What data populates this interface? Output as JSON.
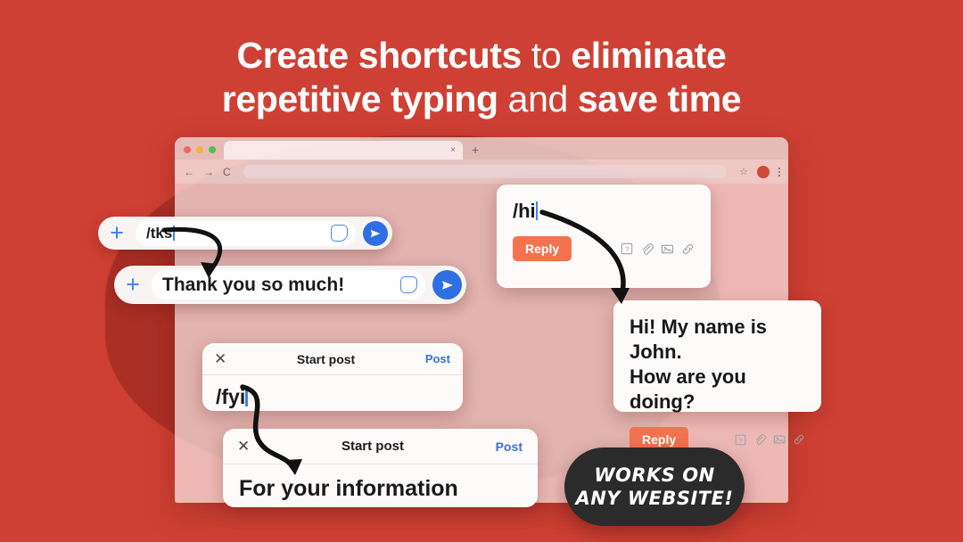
{
  "headline": {
    "line1_part1": "Create shortcuts",
    "line1_part2": " to ",
    "line1_part3": "eliminate",
    "line2_part1": "repetitive typing",
    "line2_part2": " and ",
    "line2_part3": "save time"
  },
  "browser": {
    "tab_close_label": "×",
    "new_tab_label": "+",
    "back_icon": "←",
    "forward_icon": "→",
    "reload_icon": "C",
    "bookmark_icon": "☆",
    "omnibox_value": "",
    "avatar_initial": "",
    "traffic_lights": [
      "close-red",
      "minimize-yellow",
      "maximize-green"
    ]
  },
  "chat_bars": [
    {
      "plus_label": "+",
      "text": "/tks",
      "has_caret": true,
      "sticker_icon": "sticker-icon",
      "send_icon": "send-icon"
    },
    {
      "plus_label": "+",
      "text": "Thank you so much!",
      "has_caret": false,
      "sticker_icon": "sticker-icon",
      "send_icon": "send-icon"
    }
  ],
  "reply_cards": [
    {
      "text": "/hi",
      "has_caret": true,
      "reply_label": "Reply",
      "icons": [
        "help-box-icon",
        "paperclip-icon",
        "image-icon",
        "link-icon"
      ]
    },
    {
      "text": "Hi! My name is John.\nHow are you doing?",
      "line1": "Hi! My name is John.",
      "line2": "How are you doing?",
      "has_caret": false,
      "reply_label": "Reply",
      "icons": [
        "help-box-icon",
        "paperclip-icon",
        "image-icon",
        "link-icon"
      ]
    }
  ],
  "post_cards": [
    {
      "close_label": "✕",
      "title": "Start post",
      "post_label": "Post",
      "body_text": "/fyi",
      "has_caret": true
    },
    {
      "close_label": "✕",
      "title": "Start post",
      "post_label": "Post",
      "body_text": "For your information",
      "has_caret": false
    }
  ],
  "badge": {
    "line1": "Works on",
    "line2": "any website!"
  },
  "colors": {
    "background_red": "#cf4034",
    "blob_red": "#ab2f25",
    "accent_blue": "#2f6fe4",
    "reply_coral": "#f4734f",
    "badge_dark": "#2b2b2b",
    "post_link_blue": "#3a72d4"
  }
}
